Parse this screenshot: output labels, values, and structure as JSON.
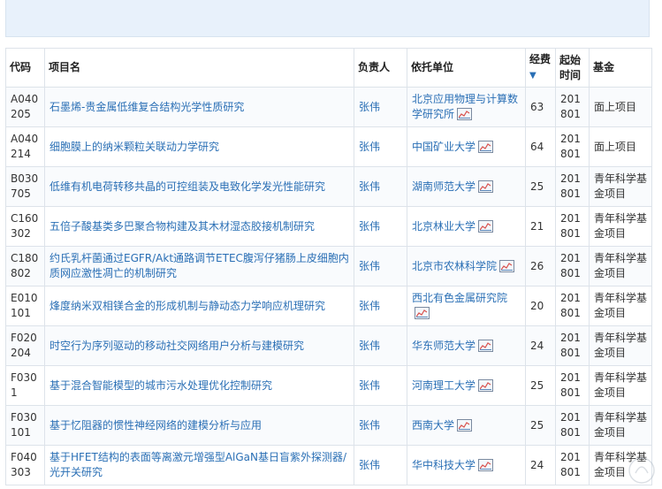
{
  "headers": {
    "code": "代码",
    "name": "项目名",
    "person": "负责人",
    "org": "依托单位",
    "fund": "经费",
    "fund_sort": "▼",
    "time": "起始时间",
    "type": "基金"
  },
  "rows": [
    {
      "code": "A040205",
      "name": "石墨烯-贵金属低维复合结构光学性质研究",
      "person": "张伟",
      "org": "北京应用物理与计算数学研究所",
      "fund": "63",
      "time": "201801",
      "type": "面上项目"
    },
    {
      "code": "A040214",
      "name": "细胞膜上的纳米颗粒关联动力学研究",
      "person": "张伟",
      "org": "中国矿业大学",
      "fund": "64",
      "time": "201801",
      "type": "面上项目"
    },
    {
      "code": "B030705",
      "name": "低维有机电荷转移共晶的可控组装及电致化学发光性能研究",
      "person": "张伟",
      "org": "湖南师范大学",
      "fund": "25",
      "time": "201801",
      "type": "青年科学基金项目"
    },
    {
      "code": "C160302",
      "name": "五倍子酸基类多巴聚合物构建及其木材湿态胶接机制研究",
      "person": "张伟",
      "org": "北京林业大学",
      "fund": "21",
      "time": "201801",
      "type": "青年科学基金项目"
    },
    {
      "code": "C180802",
      "name": "约氏乳杆菌通过EGFR/Akt通路调节ETEC腹泻仔猪肠上皮细胞内质网应激性凋亡的机制研究",
      "person": "张伟",
      "org": "北京市农林科学院",
      "fund": "26",
      "time": "201801",
      "type": "青年科学基金项目"
    },
    {
      "code": "E010101",
      "name": "烽度纳米双相镁合金的形成机制与静动态力学响应机理研究",
      "person": "张伟",
      "org": "西北有色金属研究院",
      "fund": "20",
      "time": "201801",
      "type": "青年科学基金项目"
    },
    {
      "code": "F020204",
      "name": "时空行为序列驱动的移动社交网络用户分析与建模研究",
      "person": "张伟",
      "org": "华东师范大学",
      "fund": "24",
      "time": "201801",
      "type": "青年科学基金项目"
    },
    {
      "code": "F0301",
      "name": "基于混合智能模型的城市污水处理优化控制研究",
      "person": "张伟",
      "org": "河南理工大学",
      "fund": "25",
      "time": "201801",
      "type": "青年科学基金项目"
    },
    {
      "code": "F030101",
      "name": "基于忆阻器的惯性神经网络的建模分析与应用",
      "person": "张伟",
      "org": "西南大学",
      "fund": "25",
      "time": "201801",
      "type": "青年科学基金项目"
    },
    {
      "code": "F040303",
      "name": "基于HFET结构的表面等离激元增强型AlGaN基日盲紫外探测器/光开关研究",
      "person": "张伟",
      "org": "华中科技大学",
      "fund": "24",
      "time": "201801",
      "type": "青年科学基金项目"
    }
  ],
  "icons": {
    "org_chart": "chart-icon"
  }
}
